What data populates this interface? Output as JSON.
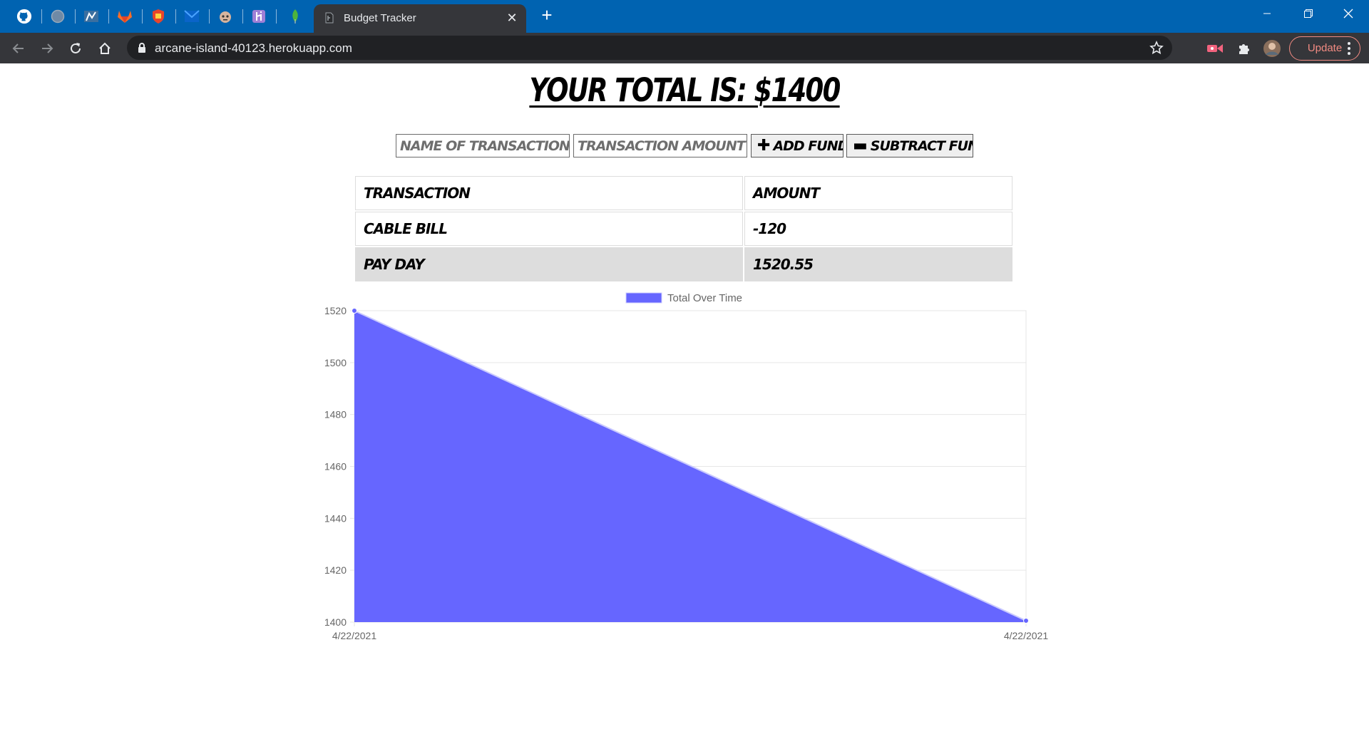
{
  "browser": {
    "tab_title": "Budget Tracker",
    "url": "arcane-island-40123.herokuapp.com",
    "update_label": "Update",
    "pinned_tabs": [
      "github-icon",
      "globe-icon",
      "chart-icon",
      "gitlab-icon",
      "shield-icon",
      "outlook-icon",
      "bot-icon",
      "heroku-icon",
      "mongodb-icon"
    ]
  },
  "page": {
    "total_text": "YOUR TOTAL IS: $1400",
    "name_placeholder": "NAME OF TRANSACTION",
    "amount_placeholder": "TRANSACTION AMOUNT",
    "add_label": "ADD FUNDS",
    "subtract_label": "SUBTRACT FUNDS",
    "table": {
      "headers": [
        "TRANSACTION",
        "AMOUNT"
      ],
      "rows": [
        {
          "name": "CABLE BILL",
          "amount": "-120"
        },
        {
          "name": "PAY DAY",
          "amount": "1520.55"
        }
      ]
    }
  },
  "chart_data": {
    "type": "area",
    "legend": [
      "Total Over Time"
    ],
    "legend_position": "top",
    "x": [
      "4/22/2021",
      "4/22/2021"
    ],
    "series": [
      {
        "name": "Total Over Time",
        "values": [
          1520.55,
          1400.55
        ]
      }
    ],
    "ylim": [
      1400,
      1520
    ],
    "yticks": [
      1400,
      1420,
      1440,
      1460,
      1480,
      1500,
      1520
    ],
    "grid": true,
    "fill_color": "#6666ff"
  }
}
